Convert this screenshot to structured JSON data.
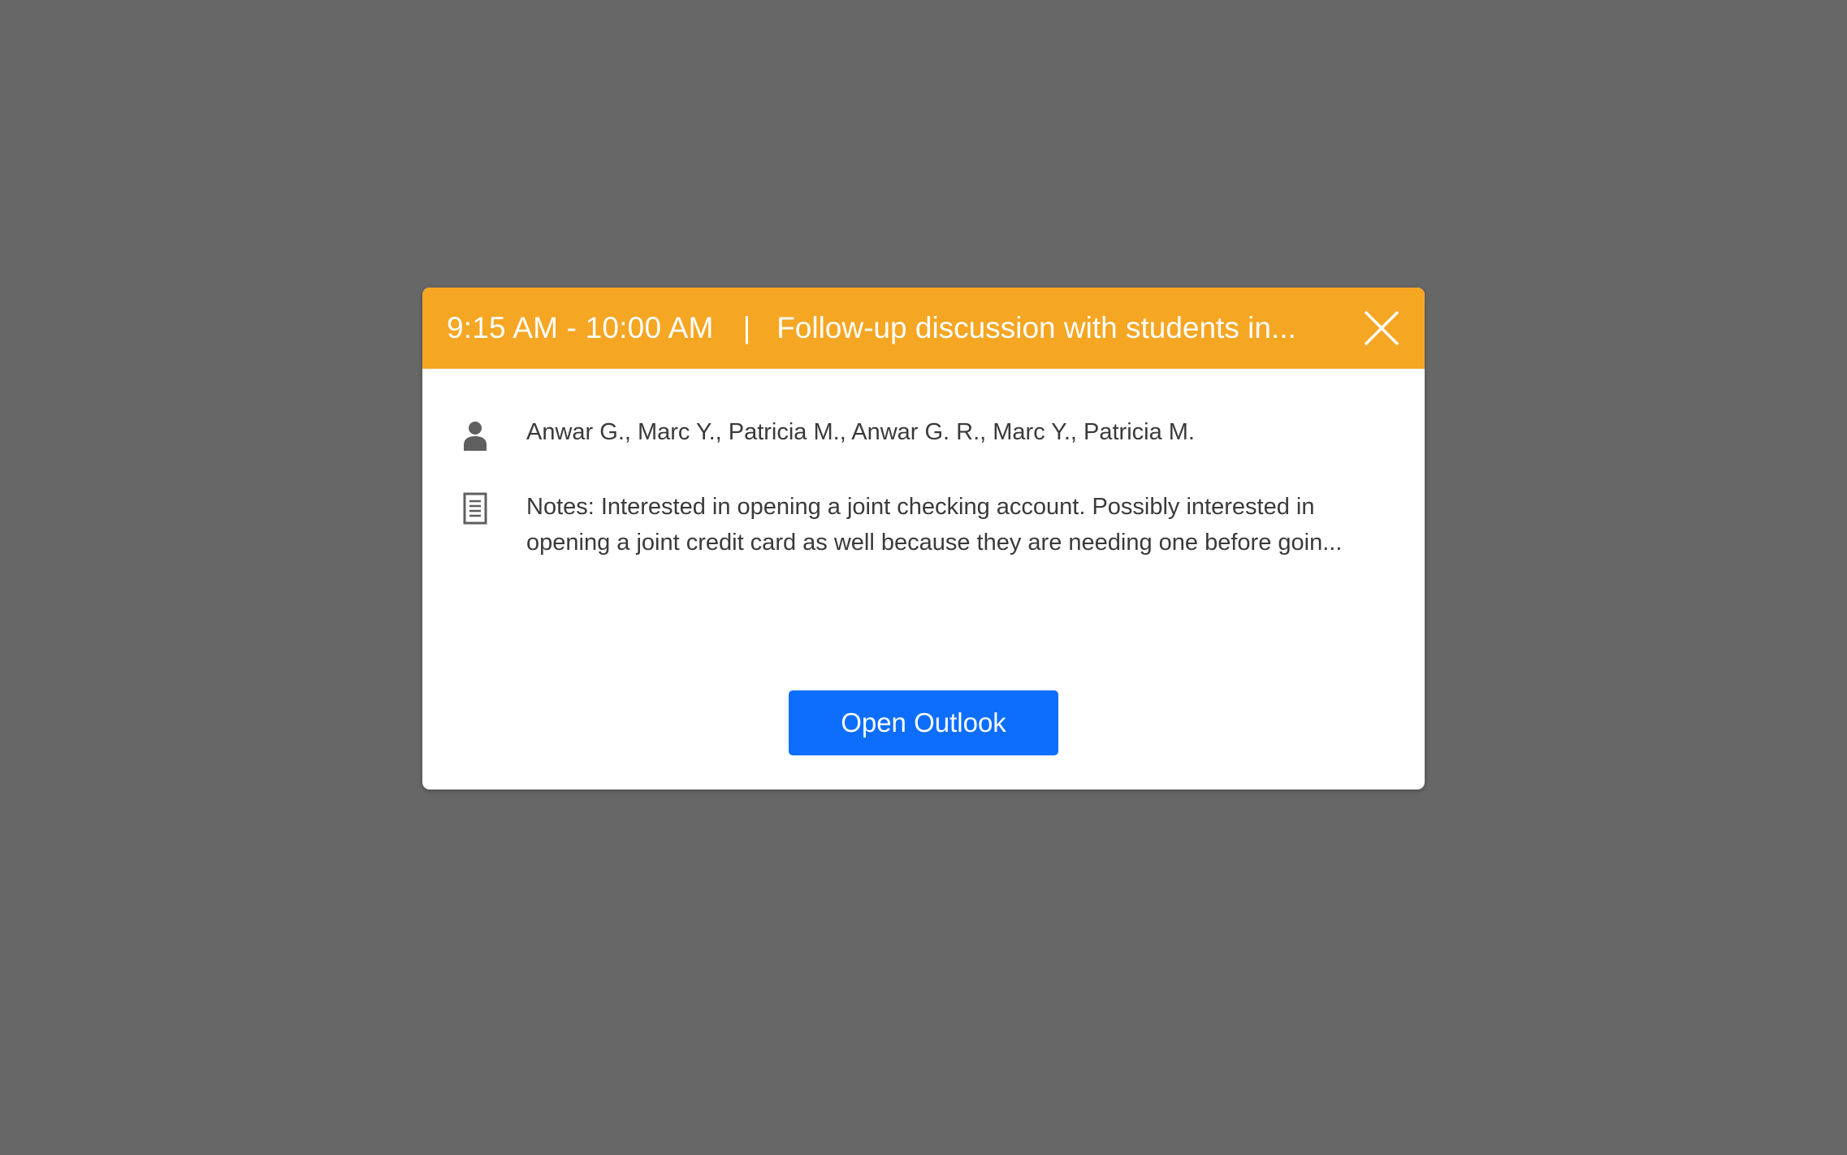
{
  "event": {
    "time_range": "9:15 AM - 10:00 AM",
    "separator": "|",
    "title": "Follow-up discussion with students in..."
  },
  "details": {
    "attendees": "Anwar G., Marc Y., Patricia M., Anwar G. R., Marc Y., Patricia M.",
    "notes": "Notes: Interested in opening a joint checking account. Possibly interested in opening a joint credit card as well because they are needing one before goin..."
  },
  "actions": {
    "open_label": "Open Outlook"
  },
  "icons": {
    "close": "close-icon",
    "attendees": "person-icon",
    "notes": "document-icon"
  },
  "colors": {
    "header": "#f5a623",
    "primary_button": "#0d6efd",
    "backdrop": "#676767"
  }
}
